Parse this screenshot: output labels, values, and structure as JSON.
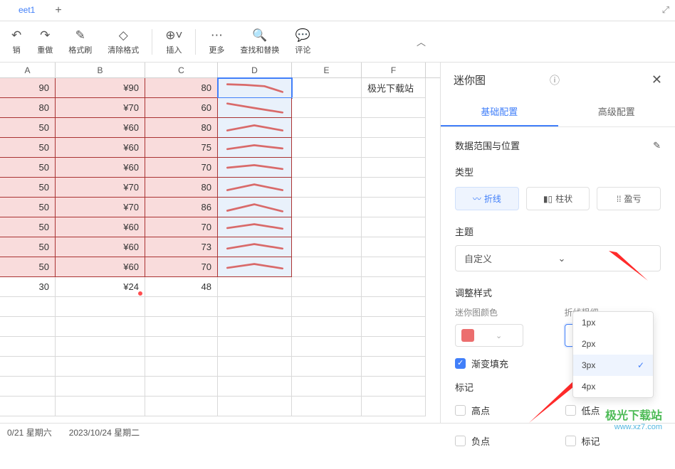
{
  "tabs": {
    "sheet1": "eet1"
  },
  "toolbar": {
    "undo": "销",
    "redo": "重做",
    "format_painter": "格式刷",
    "clear_format": "清除格式",
    "insert": "插入",
    "more": "更多",
    "find_replace": "查找和替换",
    "comment": "评论"
  },
  "columns": [
    "A",
    "B",
    "C",
    "D",
    "E",
    "F"
  ],
  "grid": {
    "rows": [
      {
        "a": "90",
        "b": "¥90",
        "c": "80"
      },
      {
        "a": "80",
        "b": "¥70",
        "c": "60"
      },
      {
        "a": "50",
        "b": "¥60",
        "c": "80"
      },
      {
        "a": "50",
        "b": "¥60",
        "c": "75"
      },
      {
        "a": "50",
        "b": "¥60",
        "c": "70"
      },
      {
        "a": "50",
        "b": "¥70",
        "c": "80"
      },
      {
        "a": "50",
        "b": "¥70",
        "c": "86"
      },
      {
        "a": "50",
        "b": "¥60",
        "c": "70"
      },
      {
        "a": "50",
        "b": "¥60",
        "c": "73"
      },
      {
        "a": "50",
        "b": "¥60",
        "c": "70"
      }
    ],
    "footer": {
      "a": "30",
      "b": "¥24",
      "c": "48"
    },
    "note_f": "极光下载站"
  },
  "side": {
    "title": "迷你图",
    "tab_basic": "基础配置",
    "tab_advanced": "高级配置",
    "range_label": "数据范围与位置",
    "type_label": "类型",
    "type_line": "折线",
    "type_bar": "柱状",
    "type_winloss": "盈亏",
    "theme_label": "主题",
    "theme_value": "自定义",
    "style_label": "调整样式",
    "color_label": "迷你图颜色",
    "weight_label": "折线粗细",
    "weight_value": "3px",
    "weight_options": [
      "1px",
      "2px",
      "3px",
      "4px"
    ],
    "gradient": "渐变填充",
    "marks_label": "标记",
    "mark_high": "高点",
    "mark_low": "低点",
    "mark_neg": "负点",
    "mark_mark": "标记"
  },
  "status": {
    "left": "0/21 星期六",
    "right": "2023/10/24 星期二"
  },
  "watermark": {
    "name": "极光下载站",
    "url": "www.xz7.com"
  }
}
